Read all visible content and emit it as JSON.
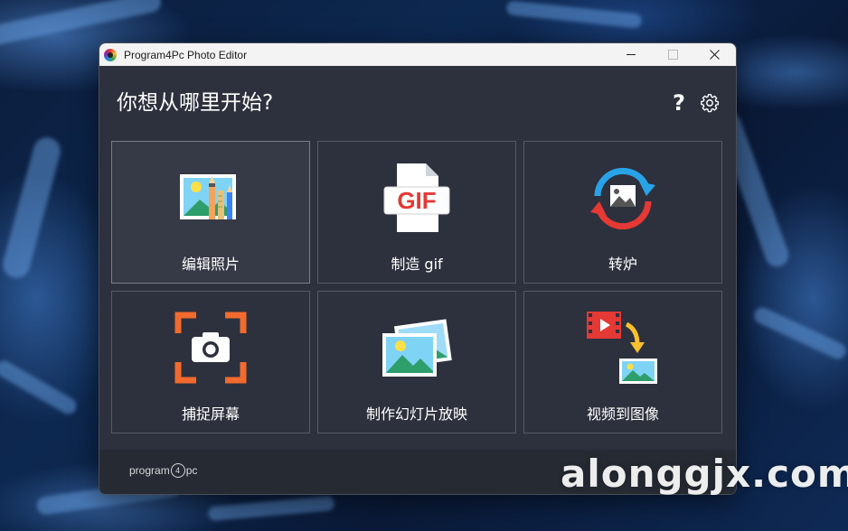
{
  "window": {
    "title": "Program4Pc Photo Editor"
  },
  "header": {
    "title": "你想从哪里开始?"
  },
  "tiles": [
    {
      "label": "编辑照片",
      "icon": "edit-photo-icon"
    },
    {
      "label": "制造 gif",
      "icon": "gif-file-icon"
    },
    {
      "label": "转炉",
      "icon": "convert-image-icon"
    },
    {
      "label": "捕捉屏幕",
      "icon": "screen-capture-icon"
    },
    {
      "label": "制作幻灯片放映",
      "icon": "slideshow-icon"
    },
    {
      "label": "视频到图像",
      "icon": "video-to-image-icon"
    }
  ],
  "gif_badge": "GIF",
  "footer": {
    "brand_pre": "program",
    "brand_num": "4",
    "brand_post": "pc"
  },
  "watermark": "alonggjx.com",
  "colors": {
    "window_bg": "#2d313d",
    "tile_border": "#575b66",
    "footer_bg": "#262a33",
    "accent_red": "#e53935",
    "accent_blue": "#29a3e8",
    "capture_orange": "#f26a2e"
  }
}
